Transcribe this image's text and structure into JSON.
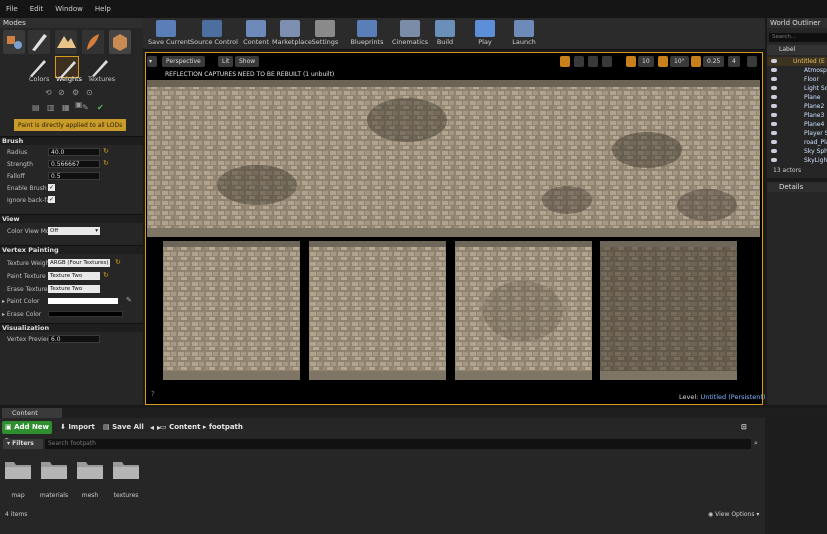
{
  "menu": [
    "File",
    "Edit",
    "Window",
    "Help"
  ],
  "modes": {
    "tab_label": "Modes",
    "subtabs": [
      "Colors",
      "Weights",
      "Textures"
    ],
    "note": "Paint is directly applied to all LODs",
    "brush_header": "Brush",
    "brush": [
      {
        "label": "Radius",
        "value": "40.0"
      },
      {
        "label": "Strength",
        "value": "0.566667"
      },
      {
        "label": "Falloff",
        "value": "0.5"
      }
    ],
    "enable_brush": "Enable Brush Fl",
    "ignore_backface": "Ignore back-fac",
    "view_header": "View",
    "color_view_label": "Color View Mo",
    "color_view_value": "Off",
    "vertex_header": "Vertex Painting",
    "texture_weight_label": "Texture Weight",
    "texture_weight_value": "ARGB (Four Textures)",
    "paint_texture_label": "Paint Texture",
    "paint_texture_value": "Texture Two",
    "erase_texture_label": "Erase Texture",
    "erase_texture_value": "Texture Two",
    "paint_color_label": "Paint Color",
    "erase_color_label": "Erase Color",
    "paint_color": "#ffffff",
    "erase_color": "#000000",
    "vis_header": "Visualization",
    "vertex_preview_label": "Vertex Preview",
    "vertex_preview_value": "6.0"
  },
  "toolbar": [
    {
      "label": "Save Current",
      "icon": "save-icon"
    },
    {
      "label": "Source Control",
      "icon": "source-control-icon"
    },
    {
      "label": "Content",
      "icon": "content-icon"
    },
    {
      "label": "Marketplace",
      "icon": "marketplace-icon"
    },
    {
      "label": "Settings",
      "icon": "settings-icon"
    },
    {
      "label": "Blueprints",
      "icon": "blueprints-icon"
    },
    {
      "label": "Cinematics",
      "icon": "cinematics-icon"
    },
    {
      "label": "Build",
      "icon": "build-icon"
    },
    {
      "label": "Play",
      "icon": "play-icon"
    },
    {
      "label": "Launch",
      "icon": "launch-icon"
    }
  ],
  "viewport": {
    "perspective": "Perspective",
    "lit": "Lit",
    "show": "Show",
    "grid_snap": "10",
    "rot_snap": "10°",
    "scale_snap": "0.25",
    "cam_speed": "4",
    "warning": "REFLECTION CAPTURES NEED TO BE REBUILT (1 unbuilt)",
    "level_label": "Level:",
    "level_value": "Untitled (Persistent)"
  },
  "outliner": {
    "tab_label": "World Outliner",
    "search_placeholder": "Search...",
    "column_label": "Label",
    "rows": [
      "Untitled (E",
      "Atmosph",
      "Floor",
      "Light So",
      "Plane",
      "Plane2",
      "Plane3",
      "Plane4",
      "Player St",
      "road_Pla",
      "Sky Sph",
      "SkyLight"
    ],
    "actor_count": "13 actors",
    "details_tab": "Details"
  },
  "content_browser": {
    "tab_label": "Content Browser",
    "add_new": "Add New",
    "import": "Import",
    "save_all": "Save All",
    "path": [
      "Content",
      "footpath"
    ],
    "filters": "Filters",
    "search_placeholder": "Search footpath",
    "folders": [
      "map",
      "materials",
      "mesh",
      "textures"
    ],
    "item_count": "4 items",
    "view_options": "View Options"
  },
  "accent_colors": {
    "selection": "#d89a1a",
    "add_new": "#2f8f2f",
    "warning": "#c99b2a"
  }
}
